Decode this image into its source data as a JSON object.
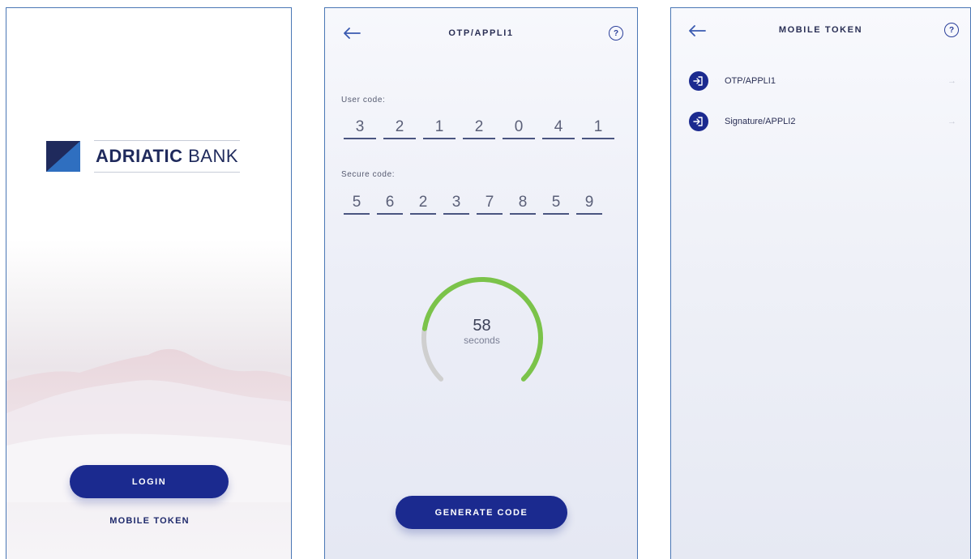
{
  "screen1": {
    "logo": {
      "bold": "ADRIATIC",
      "rest": "BANK"
    },
    "login_label": "LOGIN",
    "mobile_token_label": "MOBILE TOKEN"
  },
  "screen2": {
    "title": "OTP/APPLI1",
    "help": "?",
    "user_code_label": "User code:",
    "user_code_digits": [
      "3",
      "2",
      "1",
      "2",
      "0",
      "4",
      "1"
    ],
    "secure_code_label": "Secure code:",
    "secure_code_digits": [
      "5",
      "6",
      "2",
      "3",
      "7",
      "8",
      "5",
      "9"
    ],
    "timer_value": "58",
    "timer_unit": "seconds",
    "timer_progress": 0.8,
    "generate_label": "GENERATE CODE"
  },
  "screen3": {
    "title": "MOBILE TOKEN",
    "help": "?",
    "items": [
      {
        "label": "OTP/APPLI1",
        "arrow": "→"
      },
      {
        "label": "Signature/APPLI2",
        "arrow": "→"
      }
    ]
  },
  "colors": {
    "primary": "#1b2a8f",
    "progress": "#7bc34a",
    "progress_track": "#cfcfcf",
    "frame": "#4a77b5"
  },
  "icons": [
    "back-arrow-icon",
    "help-icon",
    "login-arrow-icon",
    "chevron-right-icon"
  ]
}
